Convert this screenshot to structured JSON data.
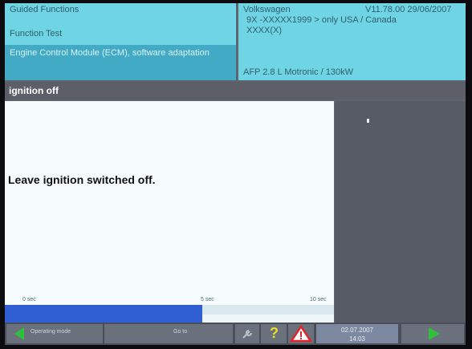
{
  "header": {
    "left_line1": "Guided Functions",
    "left_line2": "Function Test",
    "left_selected": "Engine Control Module (ECM), software adaptation",
    "brand": "Volkswagen",
    "version": "V11.78.00 29/06/2007",
    "model_line": "9X -XXXXX1999 > only USA / Canada",
    "code_line": "XXXX(X)",
    "engine": "AFP 2.8 L Motronic / 130kW"
  },
  "title": "ignition off",
  "message": "Leave ignition switched off.",
  "progress": {
    "scale_start": "0 sec",
    "scale_mid": "5 sec",
    "scale_end": "10 sec",
    "fraction": 0.6
  },
  "toolbar": {
    "operating_mode": "Operating mode",
    "goto": "Go to",
    "help": "?",
    "date": "02.07.2007",
    "time": "14:03"
  },
  "colors": {
    "header_bg": "#6fd5e4",
    "header_selected": "#42aac4",
    "progress_fill": "#2f5fd2",
    "nav_arrow": "#2fbf3a",
    "warning_red": "#e0252a"
  }
}
